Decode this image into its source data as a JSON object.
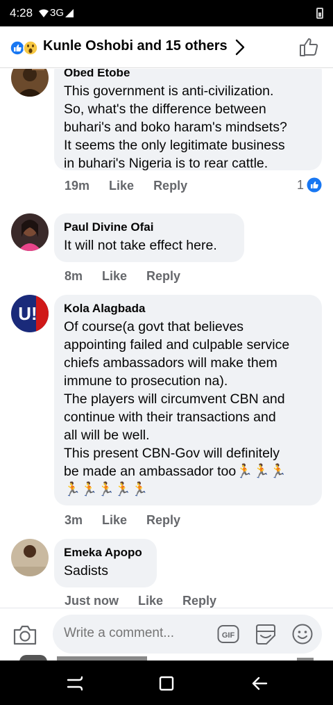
{
  "status_bar": {
    "time": "4:28",
    "network": "3G"
  },
  "header": {
    "reactors_label": "Kunle Oshobi and 15 others",
    "reaction_icons": [
      "like-icon",
      "wow-icon"
    ]
  },
  "comments": [
    {
      "author": "Obed Etobe",
      "text": "This government is anti-civilization.\nSo, what's the difference between\nbuhari's and boko haram's mindsets?\nIt seems the only legitimate business\nin buhari's Nigeria is to rear cattle.",
      "time": "19m",
      "like_label": "Like",
      "reply_label": "Reply",
      "reaction_count": "1"
    },
    {
      "author": "Paul Divine Ofai",
      "text": "It will not take effect here.",
      "time": "8m",
      "like_label": "Like",
      "reply_label": "Reply"
    },
    {
      "author": "Kola Alagbada",
      "text": "Of course(a govt that believes\nappointing failed and culpable service\nchiefs ambassadors will make them\nimmune to prosecution na).\nThe players will circumvent CBN and\ncontinue with their transactions and\nall will be well.\nThis present CBN-Gov will definitely\nbe made an ambassador too🏃🏃🏃\n🏃🏃🏃🏃🏃",
      "time": "3m",
      "like_label": "Like",
      "reply_label": "Reply"
    },
    {
      "author": "Emeka Apopo",
      "text": "Sadists",
      "time": "Just now",
      "like_label": "Like",
      "reply_label": "Reply"
    }
  ],
  "composer": {
    "placeholder": "Write a comment..."
  },
  "colors": {
    "accent": "#1877f2",
    "bubble": "#f0f2f5",
    "meta": "#65676b"
  }
}
